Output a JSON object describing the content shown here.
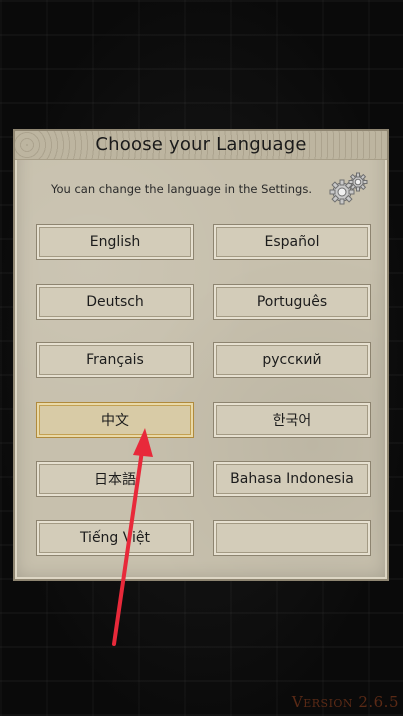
{
  "dialog": {
    "title": "Choose your Language",
    "subtitle": "You can change the language in the Settings.",
    "settings_icon": "gears-icon"
  },
  "languages": [
    {
      "label": "English"
    },
    {
      "label": "Español"
    },
    {
      "label": "Deutsch"
    },
    {
      "label": "Português"
    },
    {
      "label": "Français"
    },
    {
      "label": "русский"
    },
    {
      "label": "中文",
      "selected": true
    },
    {
      "label": "한국어"
    },
    {
      "label": "日本語"
    },
    {
      "label": "Bahasa Indonesia"
    },
    {
      "label": "Tiếng Việt"
    },
    {
      "label": ""
    }
  ],
  "footer": {
    "version": "Version 2.6.5"
  },
  "colors": {
    "panel": "#c7c0ad",
    "button": "#d3ccb9",
    "selected_border": "#b08a3c",
    "version_text": "#5a2a16",
    "annotation_arrow": "#e8293a"
  }
}
